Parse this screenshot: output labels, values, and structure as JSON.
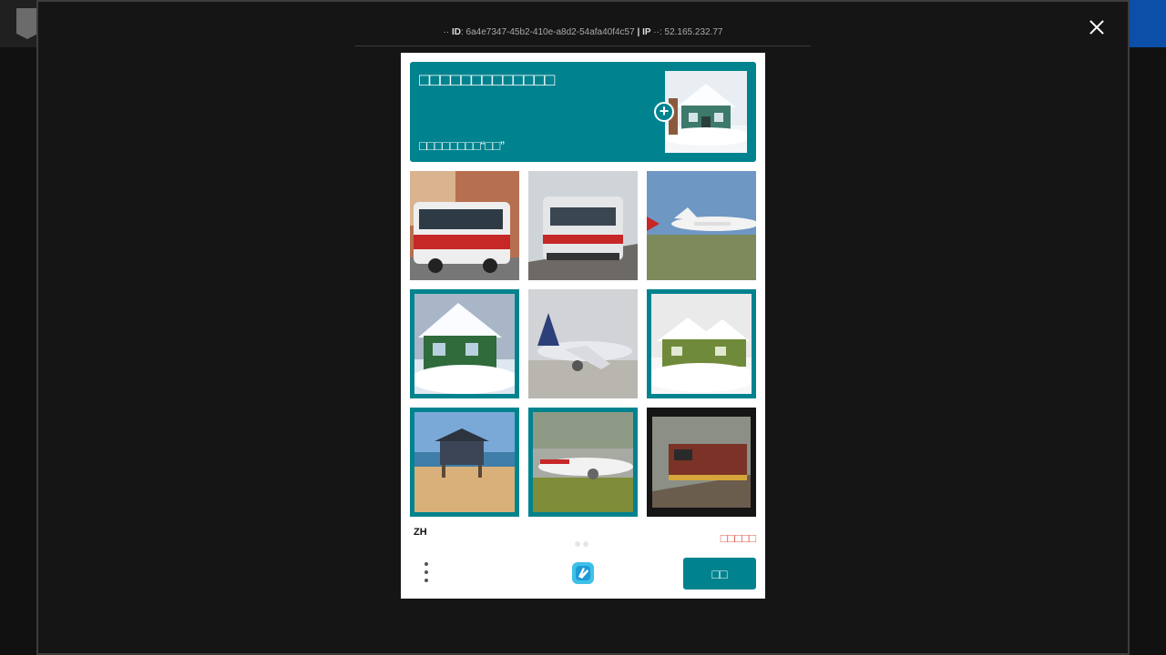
{
  "background": {
    "logo_text": "EPIC GAMES"
  },
  "modal": {
    "meta": {
      "id_prefix": "··",
      "id_label": "ID",
      "id_value": "6a4e7347-45b2-410e-a8d2-54afa40f4c57",
      "separator": "|",
      "ip_label": "IP",
      "ip_suffix": "··:",
      "ip_value": "52.165.232.77"
    }
  },
  "captcha": {
    "prompt_title": "□□□□□□□□□□□□□",
    "prompt_subtitle": "□□□□□□□□“□□”",
    "example_image": "snow-covered-house",
    "tiles": [
      {
        "subject": "bus",
        "selected": false
      },
      {
        "subject": "train",
        "selected": false
      },
      {
        "subject": "airplane",
        "selected": false
      },
      {
        "subject": "snow-covered-house",
        "selected": true
      },
      {
        "subject": "airplane",
        "selected": false
      },
      {
        "subject": "snow-covered-house",
        "selected": true
      },
      {
        "subject": "house-on-beach",
        "selected": true
      },
      {
        "subject": "airplane",
        "selected": true
      },
      {
        "subject": "train",
        "selected": false
      }
    ],
    "language": "ZH",
    "report_label": "□□□□□",
    "verify_label": "□□",
    "page_count": 2
  },
  "colors": {
    "accent": "#00838f",
    "report": "#e05a4f",
    "modal_bg": "#151515"
  }
}
